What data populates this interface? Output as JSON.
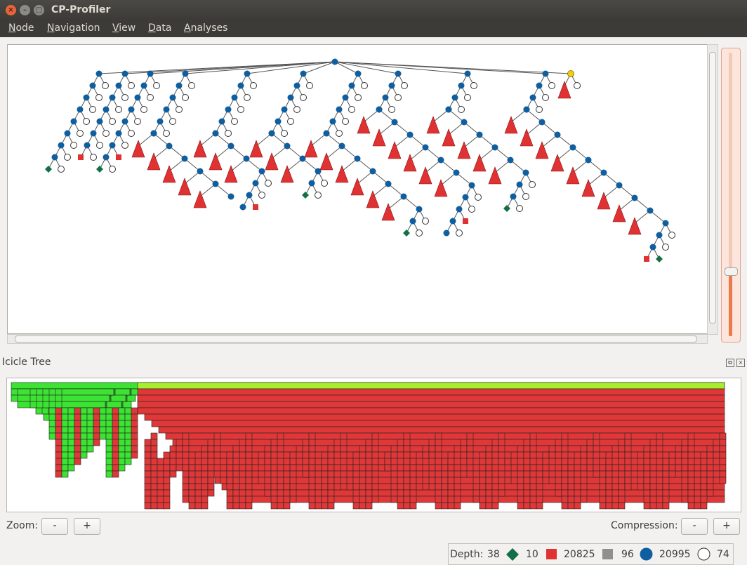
{
  "window": {
    "title": "CP-Profiler",
    "close_glyph": "×",
    "min_glyph": "–",
    "max_glyph": "□"
  },
  "menubar": {
    "items": [
      {
        "first": "N",
        "rest": "ode"
      },
      {
        "first": "N",
        "rest": "avigation"
      },
      {
        "first": "V",
        "rest": "iew"
      },
      {
        "first": "D",
        "rest": "ata"
      },
      {
        "first": "A",
        "rest": "nalyses"
      }
    ]
  },
  "colors": {
    "branch": "#0f5fa0",
    "failed": "#e03232",
    "solved": "#137046",
    "skipped": "#8f8f8f",
    "selected": "#f5cd0c",
    "icicle_solved": "#3ce332",
    "icicle_failed": "#e03838",
    "icicle_top": "#a6ee2e"
  },
  "icons": [
    "close-icon",
    "minimize-icon",
    "maximize-icon",
    "solution-diamond-icon",
    "failed-square-icon",
    "skipped-square-icon",
    "branch-circle-icon",
    "undetermined-circle-icon"
  ],
  "icicle": {
    "title": "Icicle Tree"
  },
  "zoom": {
    "label": "Zoom:",
    "minus": "-",
    "plus": "+"
  },
  "compression": {
    "label": "Compression:",
    "minus": "-",
    "plus": "+"
  },
  "status": {
    "depth_label": "Depth:",
    "depth": "38",
    "solutions": "10",
    "failures": "20825",
    "skipped": "96",
    "branches": "20995",
    "undetermined": "74"
  }
}
